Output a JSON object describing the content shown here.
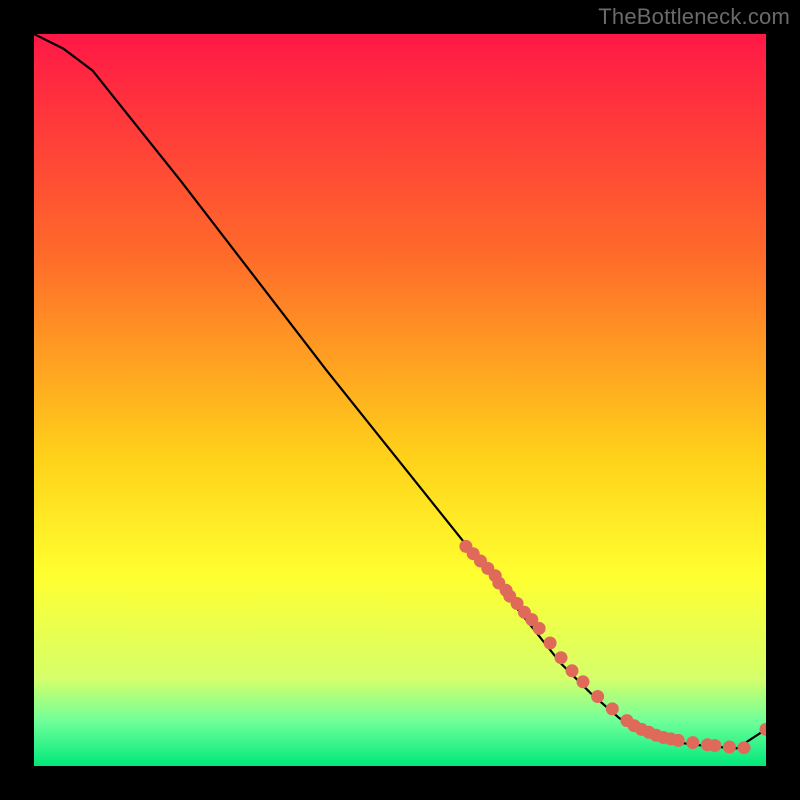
{
  "attribution": "TheBottleneck.com",
  "colors": {
    "gradient_top": "#ff1846",
    "gradient_mid1": "#ff6a2a",
    "gradient_mid2": "#ffd21a",
    "gradient_mid3": "#ffff30",
    "gradient_low1": "#d6ff6a",
    "gradient_low2": "#6dff9a",
    "gradient_bottom": "#00e87a",
    "curve": "#000000",
    "points": "#e06a5a"
  },
  "chart_data": {
    "type": "line",
    "xlabel": "",
    "ylabel": "",
    "xlim": [
      0,
      100
    ],
    "ylim": [
      0,
      100
    ],
    "curve": {
      "x": [
        0,
        4,
        8,
        12,
        20,
        30,
        40,
        50,
        60,
        68,
        72,
        76,
        80,
        84,
        88,
        92,
        96,
        100
      ],
      "y": [
        100,
        98,
        95,
        90,
        80,
        67,
        54,
        41.5,
        29,
        19,
        14,
        10,
        6.5,
        4.3,
        3.2,
        2.7,
        2.4,
        5
      ]
    },
    "series": [
      {
        "name": "points",
        "x": [
          59,
          60,
          61,
          62,
          63,
          63.5,
          64.5,
          65,
          66,
          67,
          68,
          69,
          70.5,
          72,
          73.5,
          75,
          77,
          79,
          81,
          82,
          83,
          84,
          85,
          86,
          87,
          88,
          90,
          92,
          93,
          95,
          97,
          100
        ],
        "y": [
          30,
          29,
          28,
          27,
          26,
          25,
          24,
          23.2,
          22.2,
          21,
          20,
          18.8,
          16.8,
          14.8,
          13,
          11.5,
          9.5,
          7.8,
          6.2,
          5.5,
          5.0,
          4.6,
          4.2,
          3.9,
          3.7,
          3.5,
          3.2,
          2.9,
          2.8,
          2.6,
          2.5,
          5.0
        ]
      }
    ],
    "notes": "Decreasing bottleneck curve; discrete red markers cluster on the lower-right segment where the curve flattens before a small uptick at the far right."
  }
}
